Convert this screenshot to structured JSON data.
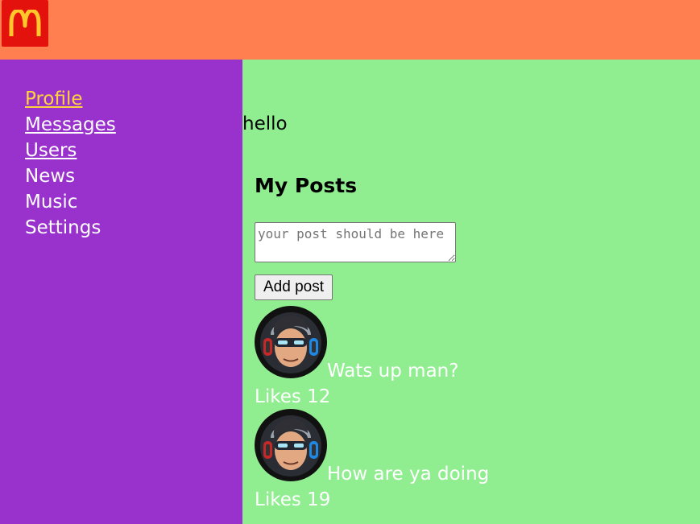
{
  "header": {
    "logo_icon": "mcdonalds-arches-icon",
    "brand_color": "#ff7f50",
    "logo_bg": "#e4120c",
    "logo_fg": "#ffc72c"
  },
  "sidebar": {
    "bg": "#9932cc",
    "items": [
      {
        "label": "Profile"
      },
      {
        "label": "Messages"
      },
      {
        "label": "Users"
      },
      {
        "label": "News"
      },
      {
        "label": "Music"
      },
      {
        "label": "Settings"
      }
    ]
  },
  "main": {
    "bg": "#90ee90",
    "greeting": "hello",
    "posts_title": "My Posts",
    "post_input": {
      "value": "",
      "placeholder": "your post should be here"
    },
    "add_button_label": "Add post",
    "posts": [
      {
        "message": "Wats up man?",
        "likes": "Likes 12",
        "avatar_icon": "gamer-avatar-icon"
      },
      {
        "message": "How are ya doing",
        "likes": "Likes 19",
        "avatar_icon": "gamer-avatar-icon"
      }
    ]
  }
}
